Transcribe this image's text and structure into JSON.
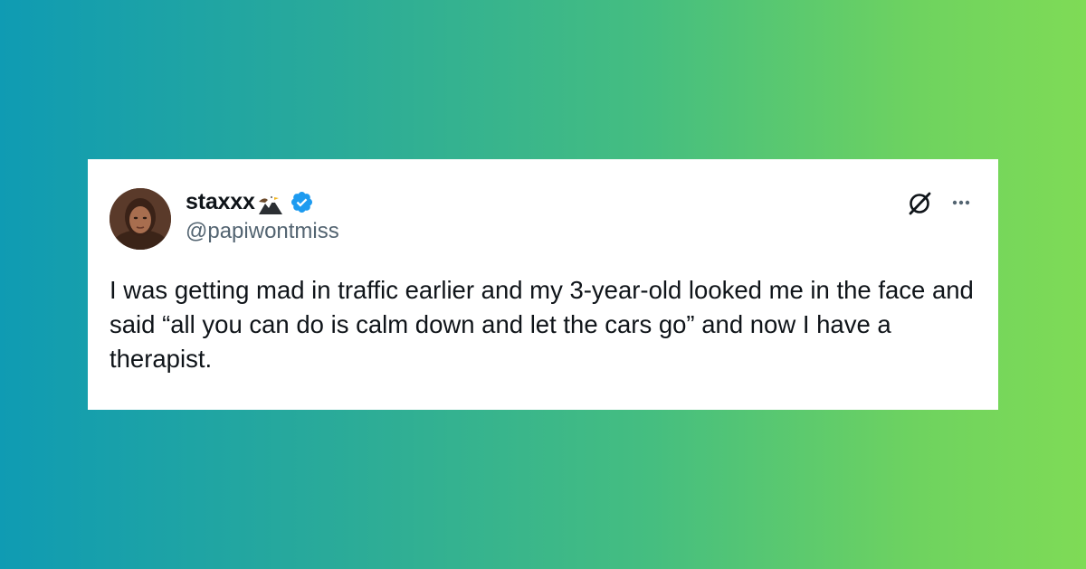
{
  "background": {
    "gradient_start": "#0f9bb3",
    "gradient_end": "#7fdb56"
  },
  "tweet": {
    "display_name": "staxxx",
    "handle": "@papiwontmiss",
    "text": "I was getting mad in traffic earlier and my 3-year-old looked me in the face and said “all you can do is calm down and let the cars go” and now I have a therapist.",
    "verified_color": "#1d9bf0",
    "icons": [
      "avatar",
      "eagle-emoji-icon",
      "verified-badge-icon",
      "grok-icon",
      "more-icon"
    ]
  }
}
